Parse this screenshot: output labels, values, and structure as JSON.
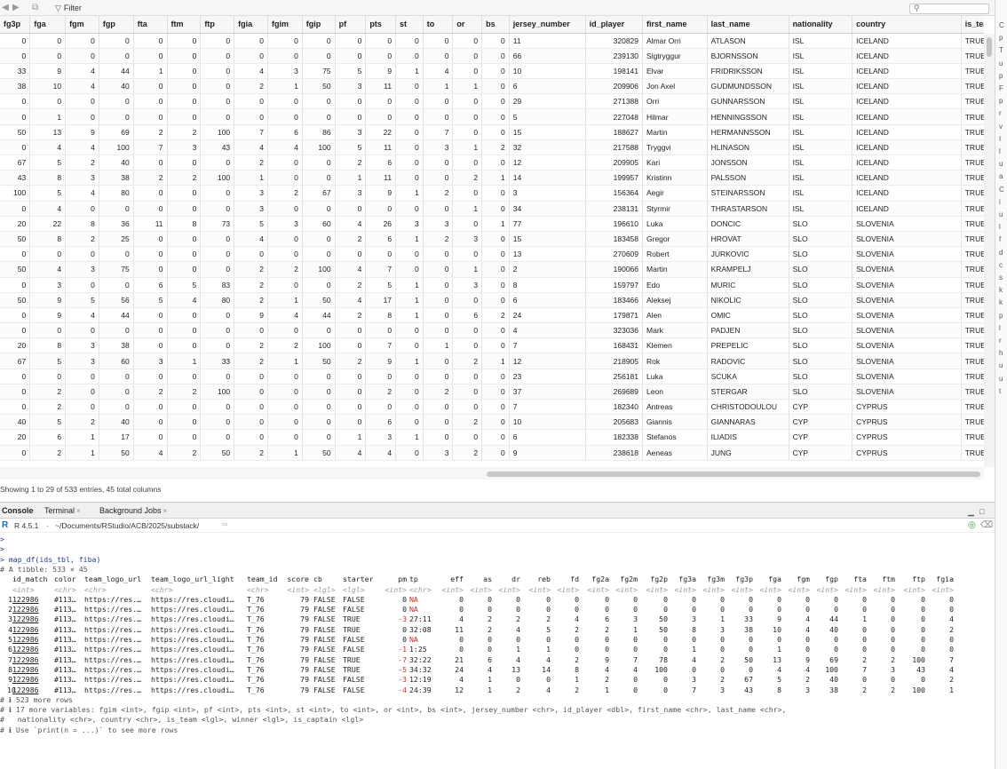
{
  "toolbar": {
    "filter_label": "Filter",
    "search_placeholder": ""
  },
  "grid": {
    "columns": [
      "fg3p",
      "fga",
      "fgm",
      "fgp",
      "fta",
      "ftm",
      "ftp",
      "fgia",
      "fgim",
      "fgip",
      "pf",
      "pts",
      "st",
      "to",
      "or",
      "bs",
      "jersey_number",
      "id_player",
      "first_name",
      "last_name",
      "nationality",
      "country",
      "is_team"
    ],
    "rows": [
      [
        "0",
        "0",
        "0",
        "0",
        "0",
        "0",
        "0",
        "0",
        "0",
        "0",
        "0",
        "0",
        "0",
        "0",
        "0",
        "0",
        "11",
        "320829",
        "Almar Orri",
        "ATLASON",
        "ISL",
        "ICELAND",
        "TRUE"
      ],
      [
        "0",
        "0",
        "0",
        "0",
        "0",
        "0",
        "0",
        "0",
        "0",
        "0",
        "0",
        "0",
        "0",
        "0",
        "0",
        "0",
        "66",
        "239130",
        "Sigtryggur",
        "BJORNSSON",
        "ISL",
        "ICELAND",
        "TRUE"
      ],
      [
        "33",
        "9",
        "4",
        "44",
        "1",
        "0",
        "0",
        "4",
        "3",
        "75",
        "5",
        "9",
        "1",
        "4",
        "0",
        "0",
        "10",
        "198141",
        "Elvar",
        "FRIDRIKSSON",
        "ISL",
        "ICELAND",
        "TRUE"
      ],
      [
        "38",
        "10",
        "4",
        "40",
        "0",
        "0",
        "0",
        "2",
        "1",
        "50",
        "3",
        "11",
        "0",
        "1",
        "1",
        "0",
        "6",
        "209906",
        "Jon Axel",
        "GUDMUNDSSON",
        "ISL",
        "ICELAND",
        "TRUE"
      ],
      [
        "0",
        "0",
        "0",
        "0",
        "0",
        "0",
        "0",
        "0",
        "0",
        "0",
        "0",
        "0",
        "0",
        "0",
        "0",
        "0",
        "29",
        "271388",
        "Orri",
        "GUNNARSSON",
        "ISL",
        "ICELAND",
        "TRUE"
      ],
      [
        "0",
        "1",
        "0",
        "0",
        "0",
        "0",
        "0",
        "0",
        "0",
        "0",
        "0",
        "0",
        "0",
        "0",
        "0",
        "0",
        "5",
        "227048",
        "Hilmar",
        "HENNINGSSON",
        "ISL",
        "ICELAND",
        "TRUE"
      ],
      [
        "50",
        "13",
        "9",
        "69",
        "2",
        "2",
        "100",
        "7",
        "6",
        "86",
        "3",
        "22",
        "0",
        "7",
        "0",
        "0",
        "15",
        "188627",
        "Martin",
        "HERMANNSSON",
        "ISL",
        "ICELAND",
        "TRUE"
      ],
      [
        "0",
        "4",
        "4",
        "100",
        "7",
        "3",
        "43",
        "4",
        "4",
        "100",
        "5",
        "11",
        "0",
        "3",
        "1",
        "2",
        "32",
        "217588",
        "Tryggvi",
        "HLINASON",
        "ISL",
        "ICELAND",
        "TRUE"
      ],
      [
        "67",
        "5",
        "2",
        "40",
        "0",
        "0",
        "0",
        "2",
        "0",
        "0",
        "2",
        "6",
        "0",
        "0",
        "0",
        "0",
        "12",
        "209905",
        "Kari",
        "JONSSON",
        "ISL",
        "ICELAND",
        "TRUE"
      ],
      [
        "43",
        "8",
        "3",
        "38",
        "2",
        "2",
        "100",
        "1",
        "0",
        "0",
        "1",
        "11",
        "0",
        "0",
        "2",
        "1",
        "14",
        "199957",
        "Kristinn",
        "PALSSON",
        "ISL",
        "ICELAND",
        "TRUE"
      ],
      [
        "100",
        "5",
        "4",
        "80",
        "0",
        "0",
        "0",
        "3",
        "2",
        "67",
        "3",
        "9",
        "1",
        "2",
        "0",
        "0",
        "3",
        "156364",
        "Aegir",
        "STEINARSSON",
        "ISL",
        "ICELAND",
        "TRUE"
      ],
      [
        "0",
        "4",
        "0",
        "0",
        "0",
        "0",
        "0",
        "3",
        "0",
        "0",
        "0",
        "0",
        "0",
        "0",
        "1",
        "0",
        "34",
        "238131",
        "Styrmir",
        "THRASTARSON",
        "ISL",
        "ICELAND",
        "TRUE"
      ],
      [
        "20",
        "22",
        "8",
        "36",
        "11",
        "8",
        "73",
        "5",
        "3",
        "60",
        "4",
        "26",
        "3",
        "3",
        "0",
        "1",
        "77",
        "196610",
        "Luka",
        "DONCIC",
        "SLO",
        "SLOVENIA",
        "TRUE"
      ],
      [
        "50",
        "8",
        "2",
        "25",
        "0",
        "0",
        "0",
        "4",
        "0",
        "0",
        "2",
        "6",
        "1",
        "2",
        "3",
        "0",
        "15",
        "183458",
        "Gregor",
        "HROVAT",
        "SLO",
        "SLOVENIA",
        "TRUE"
      ],
      [
        "0",
        "0",
        "0",
        "0",
        "0",
        "0",
        "0",
        "0",
        "0",
        "0",
        "0",
        "0",
        "0",
        "0",
        "0",
        "0",
        "13",
        "270609",
        "Robert",
        "JURKOVIC",
        "SLO",
        "SLOVENIA",
        "TRUE"
      ],
      [
        "50",
        "4",
        "3",
        "75",
        "0",
        "0",
        "0",
        "2",
        "2",
        "100",
        "4",
        "7",
        "0",
        "0",
        "1",
        "0",
        "2",
        "190066",
        "Martin",
        "KRAMPELJ",
        "SLO",
        "SLOVENIA",
        "TRUE"
      ],
      [
        "0",
        "3",
        "0",
        "0",
        "6",
        "5",
        "83",
        "2",
        "0",
        "0",
        "2",
        "5",
        "1",
        "0",
        "3",
        "0",
        "8",
        "159797",
        "Edo",
        "MURIC",
        "SLO",
        "SLOVENIA",
        "TRUE"
      ],
      [
        "50",
        "9",
        "5",
        "56",
        "5",
        "4",
        "80",
        "2",
        "1",
        "50",
        "4",
        "17",
        "1",
        "0",
        "0",
        "0",
        "6",
        "183466",
        "Aleksej",
        "NIKOLIC",
        "SLO",
        "SLOVENIA",
        "TRUE"
      ],
      [
        "0",
        "9",
        "4",
        "44",
        "0",
        "0",
        "0",
        "9",
        "4",
        "44",
        "2",
        "8",
        "1",
        "0",
        "6",
        "2",
        "24",
        "179871",
        "Alen",
        "OMIC",
        "SLO",
        "SLOVENIA",
        "TRUE"
      ],
      [
        "0",
        "0",
        "0",
        "0",
        "0",
        "0",
        "0",
        "0",
        "0",
        "0",
        "0",
        "0",
        "0",
        "0",
        "0",
        "0",
        "4",
        "323036",
        "Mark",
        "PADJEN",
        "SLO",
        "SLOVENIA",
        "TRUE"
      ],
      [
        "20",
        "8",
        "3",
        "38",
        "0",
        "0",
        "0",
        "2",
        "2",
        "100",
        "0",
        "7",
        "0",
        "1",
        "0",
        "0",
        "7",
        "168431",
        "Klemen",
        "PREPELIC",
        "SLO",
        "SLOVENIA",
        "TRUE"
      ],
      [
        "67",
        "5",
        "3",
        "60",
        "3",
        "1",
        "33",
        "2",
        "1",
        "50",
        "2",
        "9",
        "1",
        "0",
        "2",
        "1",
        "12",
        "218905",
        "Rok",
        "RADOVIC",
        "SLO",
        "SLOVENIA",
        "TRUE"
      ],
      [
        "0",
        "0",
        "0",
        "0",
        "0",
        "0",
        "0",
        "0",
        "0",
        "0",
        "0",
        "0",
        "0",
        "0",
        "0",
        "0",
        "23",
        "256181",
        "Luka",
        "SCUKA",
        "SLO",
        "SLOVENIA",
        "TRUE"
      ],
      [
        "0",
        "2",
        "0",
        "0",
        "2",
        "2",
        "100",
        "0",
        "0",
        "0",
        "0",
        "2",
        "0",
        "2",
        "0",
        "0",
        "37",
        "269689",
        "Leon",
        "STERGAR",
        "SLO",
        "SLOVENIA",
        "TRUE"
      ],
      [
        "0",
        "2",
        "0",
        "0",
        "0",
        "0",
        "0",
        "0",
        "0",
        "0",
        "0",
        "0",
        "0",
        "0",
        "0",
        "0",
        "7",
        "182340",
        "Antreas",
        "CHRISTODOULOU",
        "CYP",
        "CYPRUS",
        "TRUE"
      ],
      [
        "40",
        "5",
        "2",
        "40",
        "0",
        "0",
        "0",
        "0",
        "0",
        "0",
        "0",
        "6",
        "0",
        "0",
        "2",
        "0",
        "10",
        "205683",
        "Giannis",
        "GIANNARAS",
        "CYP",
        "CYPRUS",
        "TRUE"
      ],
      [
        "20",
        "6",
        "1",
        "17",
        "0",
        "0",
        "0",
        "0",
        "0",
        "0",
        "1",
        "3",
        "1",
        "0",
        "0",
        "0",
        "6",
        "182338",
        "Stefanos",
        "ILIADIS",
        "CYP",
        "CYPRUS",
        "TRUE"
      ],
      [
        "0",
        "2",
        "1",
        "50",
        "4",
        "2",
        "50",
        "2",
        "1",
        "50",
        "4",
        "4",
        "0",
        "3",
        "2",
        "0",
        "9",
        "238618",
        "Aeneas",
        "JUNG",
        "CYP",
        "CYPRUS",
        "TRUE"
      ]
    ]
  },
  "status_text": "Showing 1 to 29 of 533 entries, 45 total columns",
  "right_strip_chars": [
    "C",
    "p",
    "T",
    "u",
    "p",
    "F",
    "p",
    "r",
    "v",
    "I",
    "l",
    "u",
    "a",
    "C",
    "i",
    "u",
    "l",
    "f",
    "d",
    "c",
    "s",
    "k",
    "k",
    "p",
    "l",
    "r",
    "h",
    "u",
    "u",
    "t"
  ],
  "console_tabs": {
    "console": "Console",
    "terminal": "Terminal",
    "background": "Background Jobs"
  },
  "pathbar": {
    "version": "R 4.5.1",
    "path": "~/Documents/RStudio/ACB/2025/substack/"
  },
  "console": {
    "prompt_lines": [
      ">",
      ">"
    ],
    "command": "> map_df(ids_tbl, fiba)",
    "tibble_line": "# A tibble: 533 × 45",
    "header": [
      "id_match",
      "color",
      "team_logo_url",
      "team_logo_url_light",
      "team_id",
      "score",
      "cb",
      "starter",
      "pm",
      "tp",
      "eff",
      "as",
      "dr",
      "reb",
      "fd",
      "fg2a",
      "fg2m",
      "fg2p",
      "fg3a",
      "fg3m",
      "fg3p",
      "fga",
      "fgm",
      "fgp",
      "fta",
      "ftm",
      "ftp",
      "fgia"
    ],
    "types": [
      "<int>",
      "<chr>",
      "<chr>",
      "<chr>",
      "<chr>",
      "<int>",
      "<lgl>",
      "<lgl>",
      "<int>",
      "<chr>",
      "<int>",
      "<int>",
      "<int>",
      "<int>",
      "<int>",
      "<int>",
      "<int>",
      "<int>",
      "<int>",
      "<int>",
      "<int>",
      "<int>",
      "<int>",
      "<int>",
      "<int>",
      "<int>",
      "<int>",
      "<int>"
    ],
    "rows": [
      [
        "1",
        "122986",
        "#113…",
        "https://res.…",
        "https://res.cloudi…",
        "T_76",
        "79",
        "FALSE",
        "FALSE",
        "0",
        "NA",
        "0",
        "0",
        "0",
        "0",
        "0",
        "0",
        "0",
        "0",
        "0",
        "0",
        "0",
        "0",
        "0",
        "0",
        "0",
        "0",
        "0",
        "0"
      ],
      [
        "2",
        "122986",
        "#113…",
        "https://res.…",
        "https://res.cloudi…",
        "T_76",
        "79",
        "FALSE",
        "FALSE",
        "0",
        "NA",
        "0",
        "0",
        "0",
        "0",
        "0",
        "0",
        "0",
        "0",
        "0",
        "0",
        "0",
        "0",
        "0",
        "0",
        "0",
        "0",
        "0",
        "0"
      ],
      [
        "3",
        "122986",
        "#113…",
        "https://res.…",
        "https://res.cloudi…",
        "T_76",
        "79",
        "FALSE",
        "TRUE",
        "-3",
        "27:11",
        "4",
        "2",
        "2",
        "2",
        "4",
        "6",
        "3",
        "50",
        "3",
        "1",
        "33",
        "9",
        "4",
        "44",
        "1",
        "0",
        "0",
        "4"
      ],
      [
        "4",
        "122986",
        "#113…",
        "https://res.…",
        "https://res.cloudi…",
        "T_76",
        "79",
        "FALSE",
        "TRUE",
        "0",
        "32:08",
        "11",
        "2",
        "4",
        "5",
        "2",
        "2",
        "1",
        "50",
        "8",
        "3",
        "38",
        "10",
        "4",
        "40",
        "0",
        "0",
        "0",
        "2"
      ],
      [
        "5",
        "122986",
        "#113…",
        "https://res.…",
        "https://res.cloudi…",
        "T_76",
        "79",
        "FALSE",
        "FALSE",
        "0",
        "NA",
        "0",
        "0",
        "0",
        "0",
        "0",
        "0",
        "0",
        "0",
        "0",
        "0",
        "0",
        "0",
        "0",
        "0",
        "0",
        "0",
        "0",
        "0"
      ],
      [
        "6",
        "122986",
        "#113…",
        "https://res.…",
        "https://res.cloudi…",
        "T_76",
        "79",
        "FALSE",
        "FALSE",
        "-1",
        "1:25",
        "0",
        "0",
        "1",
        "1",
        "0",
        "0",
        "0",
        "0",
        "1",
        "0",
        "0",
        "1",
        "0",
        "0",
        "0",
        "0",
        "0",
        "0"
      ],
      [
        "7",
        "122986",
        "#113…",
        "https://res.…",
        "https://res.cloudi…",
        "T_76",
        "79",
        "FALSE",
        "TRUE",
        "-7",
        "32:22",
        "21",
        "6",
        "4",
        "4",
        "2",
        "9",
        "7",
        "78",
        "4",
        "2",
        "50",
        "13",
        "9",
        "69",
        "2",
        "2",
        "100",
        "7"
      ],
      [
        "8",
        "122986",
        "#113…",
        "https://res.…",
        "https://res.cloudi…",
        "T_76",
        "79",
        "FALSE",
        "TRUE",
        "-5",
        "34:32",
        "24",
        "4",
        "13",
        "14",
        "8",
        "4",
        "4",
        "100",
        "0",
        "0",
        "0",
        "4",
        "4",
        "100",
        "7",
        "3",
        "43",
        "4"
      ],
      [
        "9",
        "122986",
        "#113…",
        "https://res.…",
        "https://res.cloudi…",
        "T_76",
        "79",
        "FALSE",
        "FALSE",
        "-3",
        "12:19",
        "4",
        "1",
        "0",
        "0",
        "1",
        "2",
        "0",
        "0",
        "3",
        "2",
        "67",
        "5",
        "2",
        "40",
        "0",
        "0",
        "0",
        "2"
      ],
      [
        "10",
        "122986",
        "#113…",
        "https://res.…",
        "https://res.cloudi…",
        "T_76",
        "79",
        "FALSE",
        "FALSE",
        "-4",
        "24:39",
        "12",
        "1",
        "2",
        "4",
        "2",
        "1",
        "0",
        "0",
        "7",
        "3",
        "43",
        "8",
        "3",
        "38",
        "2",
        "2",
        "100",
        "1"
      ]
    ],
    "footer": [
      "# ℹ 523 more rows",
      "# ℹ 17 more variables: fgim <int>, fgip <int>, pf <int>, pts <int>, st <int>, to <int>, or <int>, bs <int>, jersey_number <chr>, id_player <dbl>, first_name <chr>, last_name <chr>,",
      "#   nationality <chr>, country <chr>, is_team <lgl>, winner <lgl>, is_captain <lgl>",
      "# ℹ Use `print(n = ...)` to see more rows"
    ]
  },
  "colors": {
    "na_red": "#d62b2b",
    "prompt_blue": "#1f3d8a",
    "r_blue": "#2266bb"
  }
}
